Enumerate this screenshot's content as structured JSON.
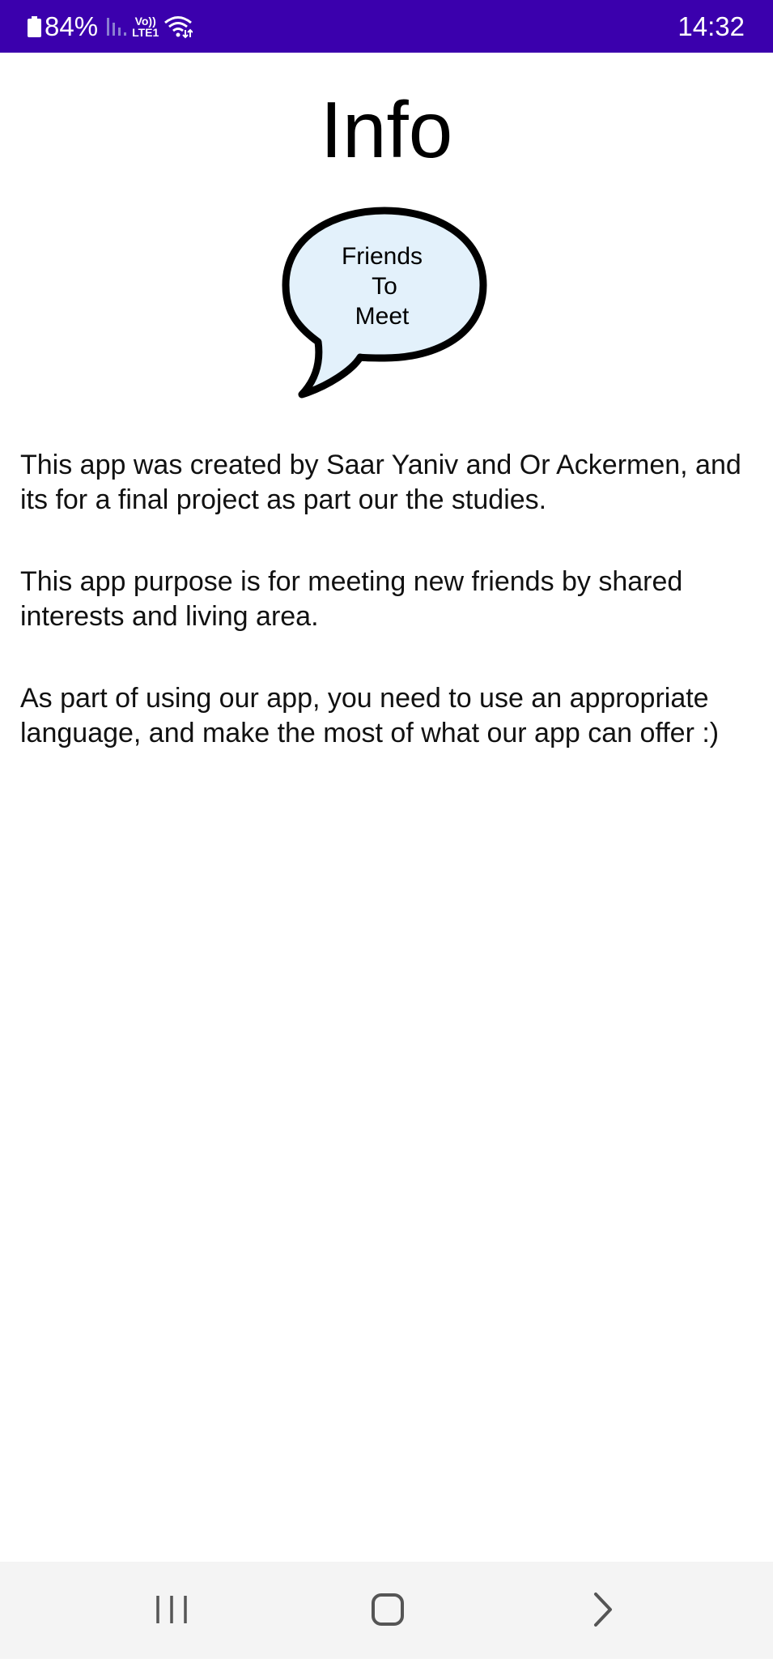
{
  "status_bar": {
    "battery": "84%",
    "volte_top": "Vo))",
    "volte_bottom": "LTE1",
    "time": "14:32",
    "background_color": "#3b00ad"
  },
  "page": {
    "title": "Info"
  },
  "logo": {
    "line1": "Friends",
    "line2": "To",
    "line3": "Meet",
    "fill_color": "#e3f1fb"
  },
  "paragraphs": [
    "This app was created by Saar Yaniv and Or Ackermen, and its for a final project as part our the studies.",
    "This app purpose is for meeting new friends by shared interests and living area.",
    "As part of using our app, you need to use an appropriate language, and make the most of what our app can offer :)"
  ],
  "nav_bar": {
    "recents_icon": "recents-icon",
    "home_icon": "home-icon",
    "back_icon": "back-chevron-icon"
  }
}
